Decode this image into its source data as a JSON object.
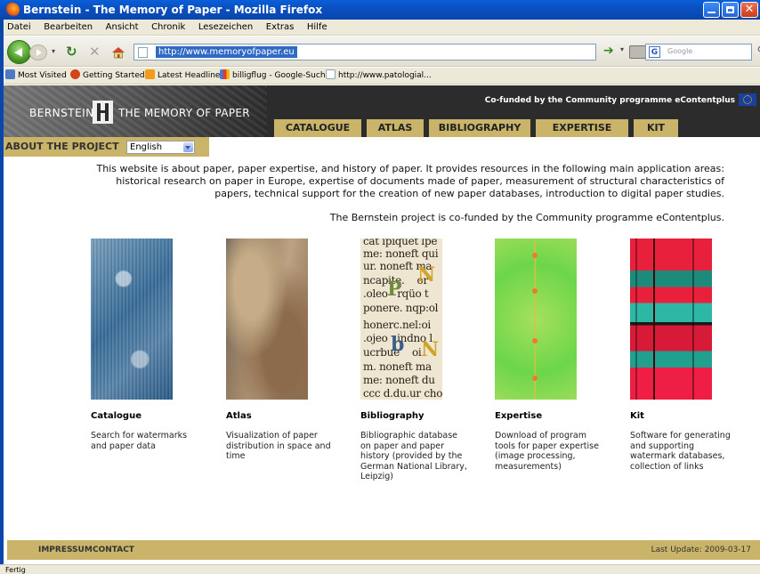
{
  "window": {
    "title": "Bernstein - The Memory of Paper - Mozilla Firefox",
    "menu": [
      "Datei",
      "Bearbeiten",
      "Ansicht",
      "Chronik",
      "Lesezeichen",
      "Extras",
      "Hilfe"
    ],
    "url": "http://www.memoryofpaper.eu",
    "search_placeholder": "Google",
    "status": "Fertig"
  },
  "bookmarks": [
    {
      "label": "Most Visited",
      "icon": "most-visited-icon"
    },
    {
      "label": "Getting Started",
      "icon": "firefox-icon"
    },
    {
      "label": "Latest Headlines",
      "icon": "rss-icon"
    },
    {
      "label": "billigflug - Google-Suche",
      "icon": "google-icon"
    },
    {
      "label": "http://www.patologial...",
      "icon": "page-icon"
    }
  ],
  "site": {
    "brand_left": "BERNSTEIN",
    "brand_right": "THE MEMORY OF PAPER",
    "cofunded": "Co-funded by the Community programme eContentplus",
    "tabs": [
      "CATALOGUE",
      "ATLAS",
      "BIBLIOGRAPHY",
      "EXPERTISE",
      "KIT"
    ],
    "about": "ABOUT THE PROJECT",
    "language": "English",
    "intro": "This website is about paper, paper expertise, and history of paper. It provides resources in the following main application areas: historical research on paper in Europe, expertise of documents made of paper, measurement of structural characteristics of papers, technical support for the creation of new paper databases, introduction to digital paper studies.",
    "cofund_line": "The Bernstein project is co-funded by the Community programme eContentplus.",
    "cards": [
      {
        "title": "Catalogue",
        "desc": "Search for watermarks and paper data"
      },
      {
        "title": "Atlas",
        "desc": "Visualization of paper distribution in space and time"
      },
      {
        "title": "Bibliography",
        "desc": "Bibliographic database on paper and paper history (provided by the German National Library, Leipzig)"
      },
      {
        "title": "Expertise",
        "desc": "Download of program tools for paper expertise (image processing, measurements)"
      },
      {
        "title": "Kit",
        "desc": "Software for generating and supporting watermark databases, collection of links"
      }
    ],
    "footer_links": [
      "IMPRESSUM",
      "CONTACT"
    ],
    "last_update": "Last Update: 2009-03-17",
    "accent": "#c9b46a"
  }
}
